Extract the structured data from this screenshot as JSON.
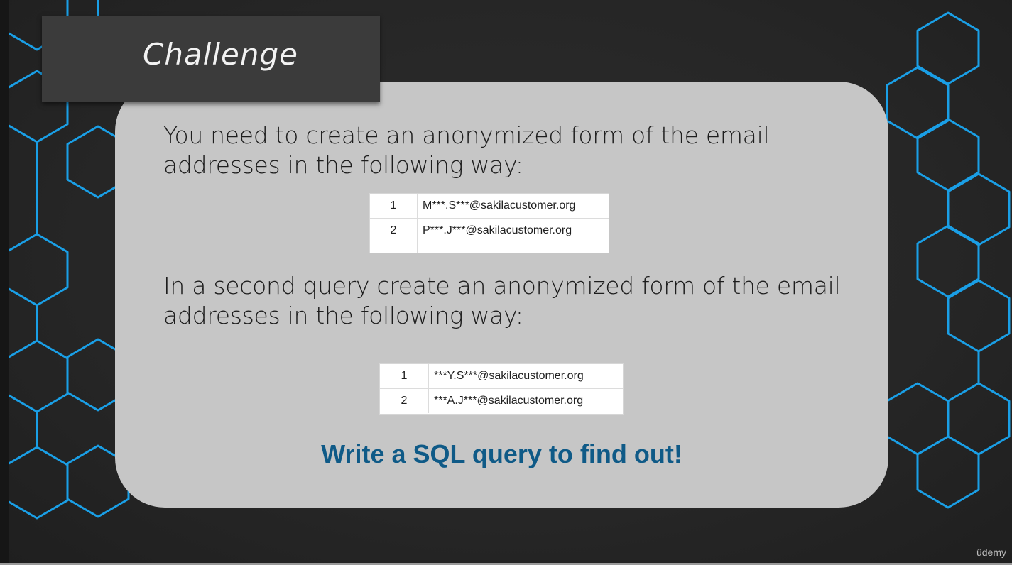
{
  "slide": {
    "title": "Challenge",
    "paragraph_1": "You need to create an anonymized form of the email addresses in the following way:",
    "table_1": [
      {
        "row": "1",
        "email": "M***.S***@sakilacustomer.org"
      },
      {
        "row": "2",
        "email": "P***.J***@sakilacustomer.org"
      }
    ],
    "paragraph_2": "In a second query create an anonymized form of the email addresses in the following way:",
    "table_2": [
      {
        "row": "1",
        "email": "***Y.S***@sakilacustomer.org"
      },
      {
        "row": "2",
        "email": "***A.J***@sakilacustomer.org"
      }
    ],
    "call_to_action": "Write a SQL query to find out!",
    "brand": "ûdemy"
  },
  "colors": {
    "background": "#262626",
    "card": "#c6c6c6",
    "title_box": "#3b3b3b",
    "hex_lines": "#1a9fe6",
    "call_to_action": "#0f5a87"
  }
}
